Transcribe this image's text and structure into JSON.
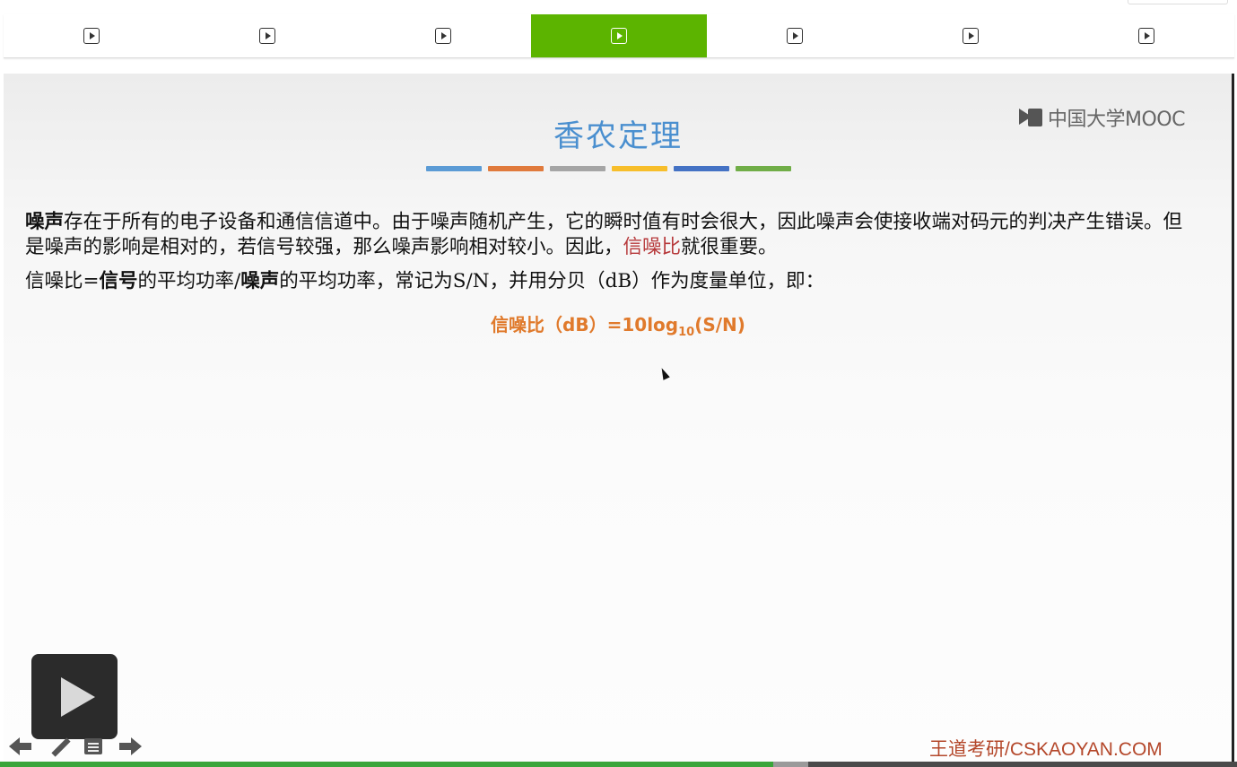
{
  "tabs": [
    {
      "name": "tab-1",
      "active": false
    },
    {
      "name": "tab-2",
      "active": false
    },
    {
      "name": "tab-3",
      "active": false
    },
    {
      "name": "tab-4",
      "active": true
    },
    {
      "name": "tab-5",
      "active": false
    },
    {
      "name": "tab-6",
      "active": false
    },
    {
      "name": "tab-7",
      "active": false
    }
  ],
  "tab_icon": "play-icon",
  "colors": {
    "active_tab": "#5cb400",
    "title": "#4a8fcf",
    "highlight_red": "#b6383a",
    "formula": "#e07a2c",
    "watermark": "#b4472a",
    "progress": "#3aa53a",
    "title_bars": [
      "#5b9bd5",
      "#e07a3c",
      "#a5a5a5",
      "#f7be2b",
      "#4472c4",
      "#70ad47"
    ]
  },
  "slide": {
    "logo_text": "中国大学MOOC",
    "title": "香农定理",
    "para1": {
      "bold_start": "噪声",
      "text_before": "存在于所有的电子设备和通信信道中。由于噪声随机产生，它的瞬时值有时会很大，因此噪声会使接收端对码元的判决产生错误。但是噪声的影响是相对的，若信号较强，那么噪声影响相对较小。因此，",
      "highlight": "信噪比",
      "text_after": "就很重要。"
    },
    "para2": {
      "part1": "信噪比=",
      "bold1": "信号",
      "part2": "的平均功率/",
      "bold2": "噪声",
      "part3": "的平均功率，常记为S/N，并用分贝（dB）作为度量单位，即："
    },
    "formula": {
      "main": "信噪比（dB）=10log",
      "sub": "10",
      "tail": "(S/N)"
    },
    "watermark": "王道考研/CSKAOYAN.COM"
  },
  "player": {
    "progress_fraction": 0.625,
    "buffered_fraction": 0.653,
    "controls": [
      "arrow-left-icon",
      "pen-icon",
      "menu-icon",
      "arrow-right-icon"
    ]
  }
}
